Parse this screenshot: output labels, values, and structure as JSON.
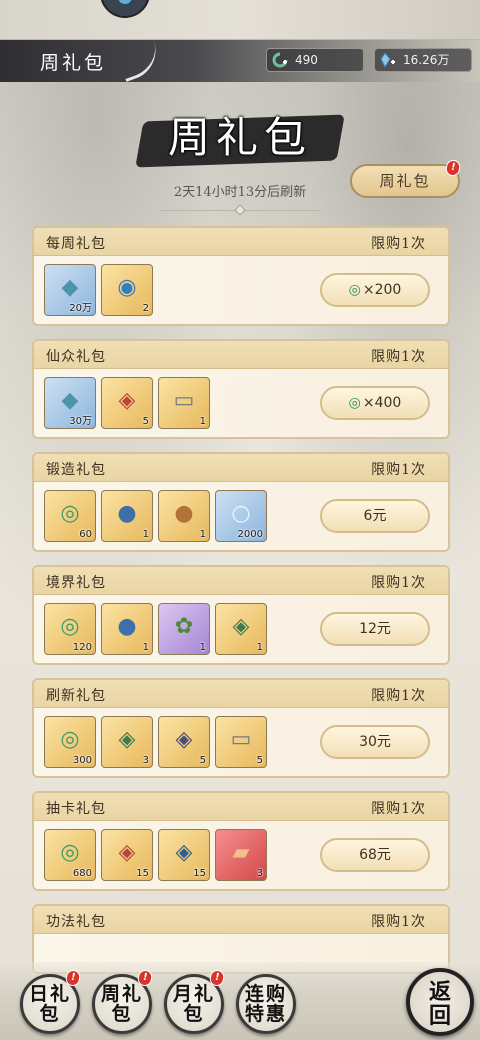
{
  "header": {
    "title": "周礼包",
    "resources": [
      {
        "icon": "jade-icon",
        "value": "490"
      },
      {
        "icon": "spirit-stone-icon",
        "value": "16.26万"
      }
    ]
  },
  "banner": {
    "title": "周礼包",
    "refresh_text": "2天14小时13分后刷新",
    "tab_button": "周礼包",
    "badge": "!"
  },
  "packs": [
    {
      "name": "每周礼包",
      "limit": "限购1次",
      "items": [
        {
          "icon": "crystal-shard-icon",
          "quality": "blue",
          "count": "20万"
        },
        {
          "icon": "moon-orb-icon",
          "quality": "gold",
          "count": "2"
        }
      ],
      "price": "×200",
      "price_icon": "jade-icon"
    },
    {
      "name": "仙众礼包",
      "limit": "限购1次",
      "items": [
        {
          "icon": "crystal-shard-icon",
          "quality": "blue",
          "count": "30万"
        },
        {
          "icon": "red-token-icon",
          "quality": "gold",
          "count": "5"
        },
        {
          "icon": "scroll-icon",
          "quality": "gold",
          "count": "1"
        }
      ],
      "price": "×400",
      "price_icon": "jade-icon"
    },
    {
      "name": "锻造礼包",
      "limit": "限购1次",
      "items": [
        {
          "icon": "jade-ring-icon",
          "quality": "gold",
          "count": "60"
        },
        {
          "icon": "blue-pouch-icon",
          "quality": "gold",
          "count": "1"
        },
        {
          "icon": "brown-pouch-icon",
          "quality": "gold",
          "count": "1"
        },
        {
          "icon": "pearl-icon",
          "quality": "blue",
          "count": "2000"
        }
      ],
      "price": "6元",
      "price_icon": ""
    },
    {
      "name": "境界礼包",
      "limit": "限购1次",
      "items": [
        {
          "icon": "jade-ring-icon",
          "quality": "gold",
          "count": "120"
        },
        {
          "icon": "blue-pouch-icon",
          "quality": "gold",
          "count": "1"
        },
        {
          "icon": "herb-icon",
          "quality": "purple",
          "count": "1"
        },
        {
          "icon": "green-token-icon",
          "quality": "gold",
          "count": "1"
        }
      ],
      "price": "12元",
      "price_icon": ""
    },
    {
      "name": "刷新礼包",
      "limit": "限购1次",
      "items": [
        {
          "icon": "jade-ring-icon",
          "quality": "gold",
          "count": "300"
        },
        {
          "icon": "green-token-icon",
          "quality": "gold",
          "count": "3"
        },
        {
          "icon": "purple-token-icon",
          "quality": "gold",
          "count": "5"
        },
        {
          "icon": "scroll-icon",
          "quality": "gold",
          "count": "5"
        }
      ],
      "price": "30元",
      "price_icon": ""
    },
    {
      "name": "抽卡礼包",
      "limit": "限购1次",
      "items": [
        {
          "icon": "jade-ring-icon",
          "quality": "gold",
          "count": "680"
        },
        {
          "icon": "red-token-icon",
          "quality": "gold",
          "count": "15"
        },
        {
          "icon": "blue-token-icon",
          "quality": "gold",
          "count": "15"
        },
        {
          "icon": "red-card-icon",
          "quality": "red",
          "count": "3"
        }
      ],
      "price": "68元",
      "price_icon": ""
    },
    {
      "name": "功法礼包",
      "limit": "限购1次",
      "items": [],
      "price": "",
      "price_icon": ""
    }
  ],
  "nav": {
    "daily": "日礼包",
    "weekly": "周礼包",
    "monthly": "月礼包",
    "continuous": "连购特惠",
    "back": "返回",
    "badge": "!"
  },
  "colors": {
    "accent_gold": "#e2c58d",
    "badge_red": "#d8352c",
    "jade_green": "#2f8c63"
  }
}
